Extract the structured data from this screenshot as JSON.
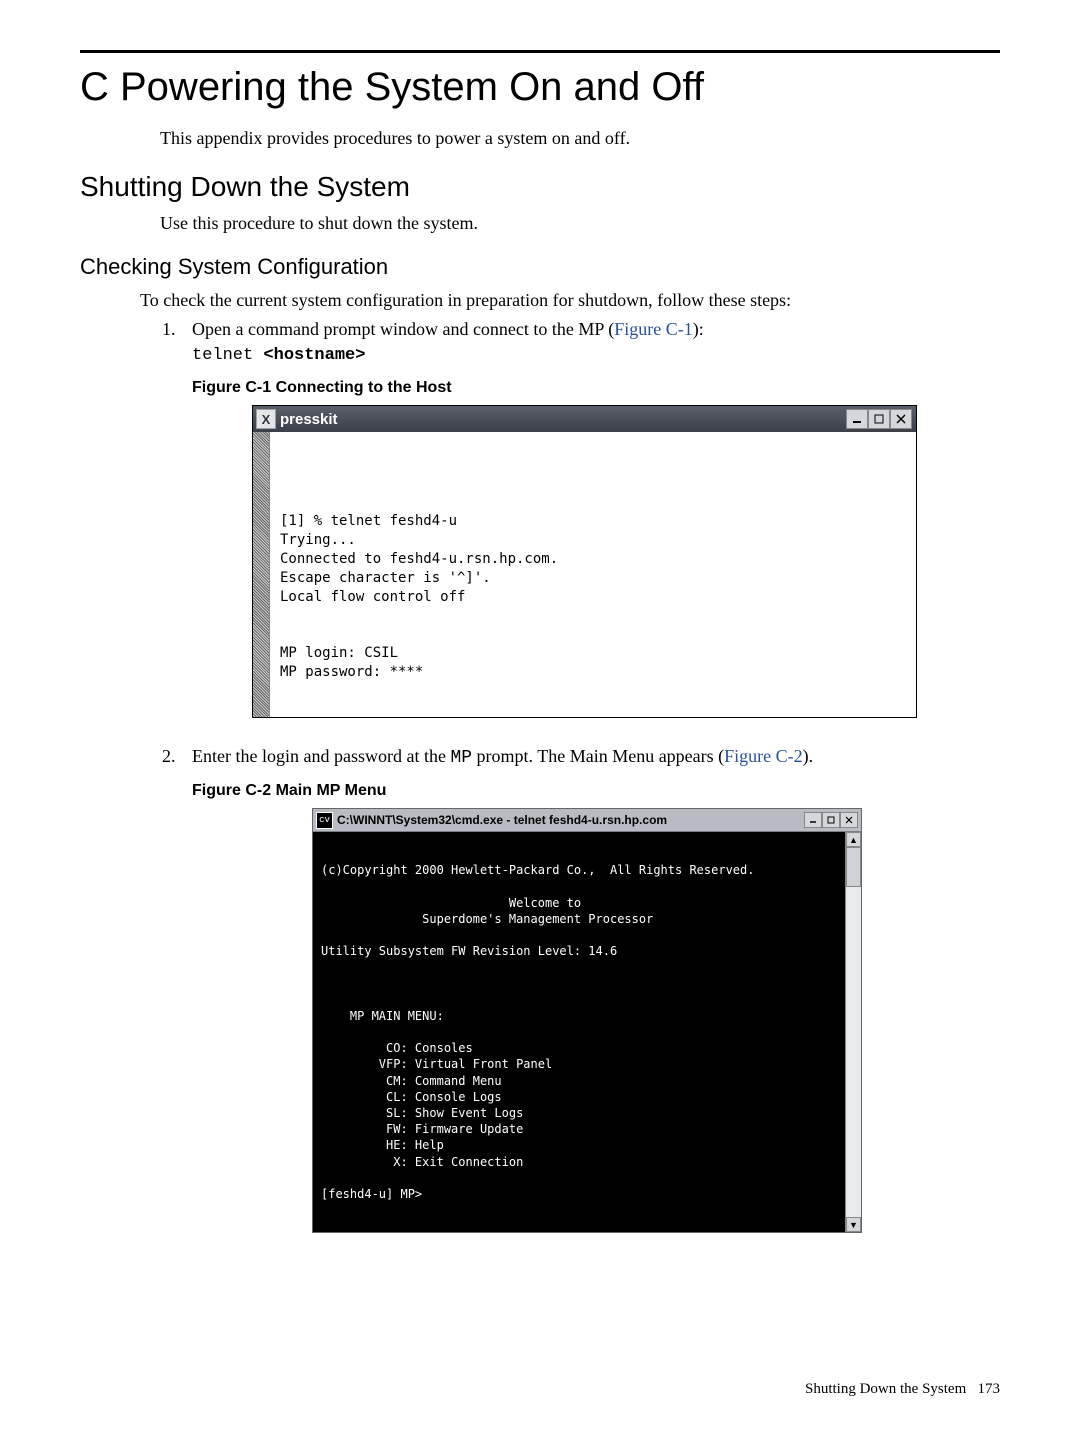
{
  "title": "C Powering the System On and Off",
  "intro": "This appendix provides procedures to power a system on and off.",
  "section": "Shutting Down the System",
  "section_text": "Use this procedure to shut down the system.",
  "subsection": "Checking System Configuration",
  "subsection_text": "To check the current system configuration in preparation for shutdown, follow these steps:",
  "step1_text": "Open a command prompt window and connect to the MP (",
  "step1_ref": "Figure C-1",
  "step1_after": "):",
  "step1_code_prefix": "telnet ",
  "step1_code_bold": "<hostname>",
  "fig1_caption": "Figure C-1  Connecting to the Host",
  "win1_title": "presskit",
  "win1_iconletter": "X",
  "term1": "[1] % telnet feshd4-u\nTrying...\nConnected to feshd4-u.rsn.hp.com.\nEscape character is '^]'.\nLocal flow control off\n\n\nMP login: CSIL\nMP password: ****",
  "step2_text": "Enter the login and password at the ",
  "step2_code": "MP",
  "step2_mid": " prompt. The Main Menu appears (",
  "step2_ref": "Figure C-2",
  "step2_after": ").",
  "fig2_caption": "Figure C-2  Main MP Menu",
  "win2_title": "C:\\WINNT\\System32\\cmd.exe - telnet feshd4-u.rsn.hp.com",
  "win2_iconletter": "cv",
  "term2": "\n(c)Copyright 2000 Hewlett-Packard Co.,  All Rights Reserved.\n\n                          Welcome to\n              Superdome's Management Processor\n\nUtility Subsystem FW Revision Level: 14.6\n\n\n\n    MP MAIN MENU:\n\n         CO: Consoles\n        VFP: Virtual Front Panel\n         CM: Command Menu\n         CL: Console Logs\n         SL: Show Event Logs\n         FW: Firmware Update\n         HE: Help\n          X: Exit Connection\n\n[feshd4-u] MP>",
  "footer_text": "Shutting Down the System",
  "footer_page": "173"
}
